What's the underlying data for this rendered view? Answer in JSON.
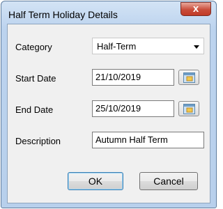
{
  "window": {
    "title": "Half Term Holiday Details",
    "close_glyph": "x"
  },
  "form": {
    "category_label": "Category",
    "category_value": "Half-Term",
    "start_label": "Start Date",
    "start_value": "21/10/2019",
    "end_label": "End Date",
    "end_value": "25/10/2019",
    "description_label": "Description",
    "description_value": "Autumn Half Term"
  },
  "buttons": {
    "ok": "OK",
    "cancel": "Cancel"
  },
  "icons": {
    "calendar": "calendar-icon",
    "dropdown": "chevron-down-icon"
  }
}
